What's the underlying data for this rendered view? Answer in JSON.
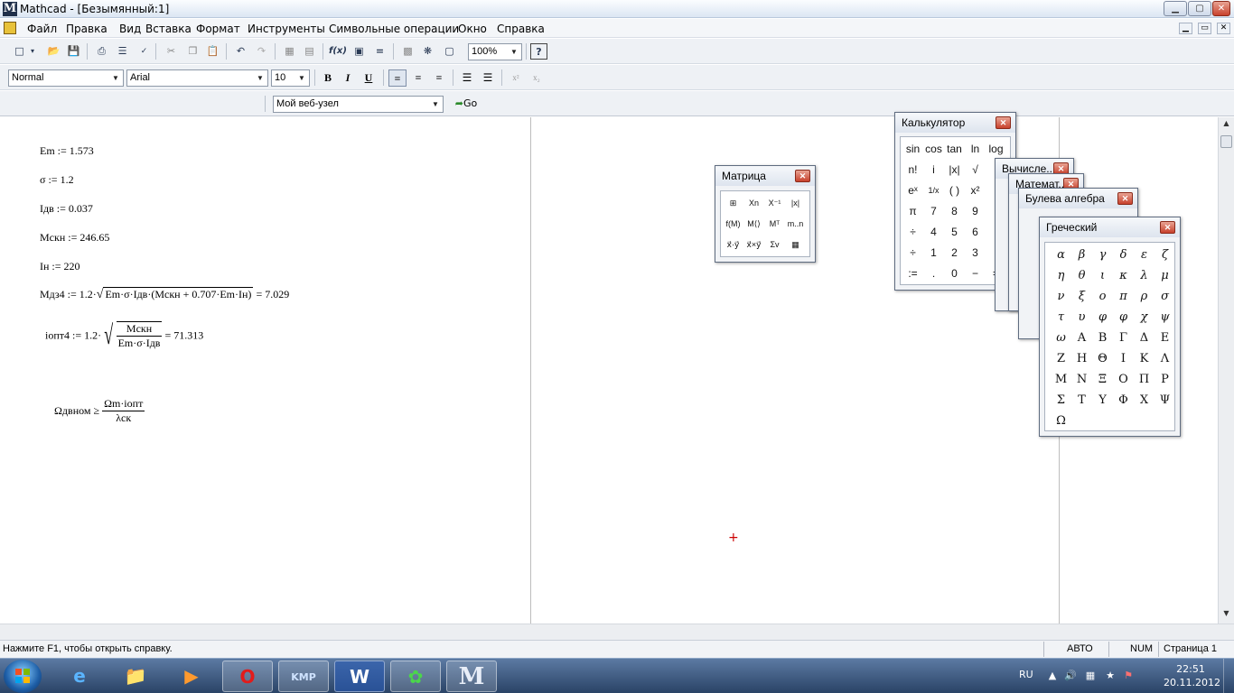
{
  "window": {
    "title": "Mathcad - [Безымянный:1]",
    "app_letter": "M",
    "minimize": "▁",
    "maximize": "▢",
    "close": "✕"
  },
  "menu": {
    "items": [
      "Файл",
      "Правка",
      "Вид",
      "Вставка",
      "Формат",
      "Инструменты",
      "Символьные операции",
      "Окно",
      "Справка"
    ],
    "mdi_minimize": "▁",
    "mdi_restore": "▭",
    "mdi_close": "✕"
  },
  "toolbar": {
    "zoom_value": "100%",
    "style_value": "Normal",
    "font_value": "Arial",
    "size_value": "10",
    "bold": "B",
    "italic": "I",
    "underline": "U",
    "superscript": "x²",
    "subscript": "x₂",
    "web_value": "Мой веб-узел",
    "go_label": "Go",
    "help_icon": "?"
  },
  "worksheet": {
    "lines": [
      "Em := 1.573",
      "σ := 1.2",
      "Iдв := 0.037",
      "Mскн := 246.65",
      "Iн := 220"
    ],
    "mdz4": {
      "lhs": "Mдз4 := 1.2·",
      "radicand": "Em·σ·Iдв·(Mскн + 0.707·Em·Iн)",
      "result": "= 7.029"
    },
    "iopt4": {
      "lhs": "iопт4 := 1.2·",
      "numerator": "Mскн",
      "denominator": "Em·σ·Iдв",
      "result": "= 71.313"
    },
    "omega": {
      "lhs": "Ωдвном ≥",
      "numerator": "Ωm·iопт",
      "denominator": "λск"
    },
    "cursor": "+"
  },
  "palettes": {
    "matrix": {
      "title": "Матрица",
      "cells": [
        "⊞",
        "Xn",
        "X⁻¹",
        "|x|",
        "f(M)",
        "M⟨⟩",
        "Mᵀ",
        "m..n",
        "x⃗·y⃗",
        "x⃗×y⃗",
        "Σv",
        "▦"
      ]
    },
    "calculator": {
      "title": "Калькулятор",
      "cells": [
        "sin",
        "cos",
        "tan",
        "ln",
        "log",
        "n!",
        "i",
        "|x|",
        "√",
        "eˣ",
        "1/x",
        "( )",
        "x²",
        "π",
        "7",
        "8",
        "9",
        "÷",
        "4",
        "5",
        "6",
        "÷",
        "1",
        "2",
        "3",
        ":=",
        ".",
        "0",
        "−",
        "="
      ]
    },
    "evaluation": {
      "title": "Вычисле..."
    },
    "calculus": {
      "title": "Математ..."
    },
    "boolean": {
      "title": "Булева алгебра"
    },
    "greek": {
      "title": "Греческий",
      "lower": [
        "α",
        "β",
        "γ",
        "δ",
        "ε",
        "ζ",
        "η",
        "θ",
        "ι",
        "κ",
        "λ",
        "μ",
        "ν",
        "ξ",
        "ο",
        "π",
        "ρ",
        "σ",
        "τ",
        "υ",
        "φ",
        "φ",
        "χ",
        "ψ",
        "ω"
      ],
      "upper": [
        "Α",
        "Β",
        "Γ",
        "Δ",
        "Ε",
        "Ζ",
        "Η",
        "Θ",
        "Ι",
        "Κ",
        "Λ",
        "Μ",
        "Ν",
        "Ξ",
        "Ο",
        "Π",
        "Ρ",
        "Σ",
        "Τ",
        "Υ",
        "Φ",
        "Χ",
        "Ψ",
        "Ω"
      ]
    }
  },
  "status": {
    "help": "Нажмите F1, чтобы открыть справку.",
    "auto": "АВТО",
    "num": "NUM",
    "page": "Страница 1"
  },
  "taskbar": {
    "apps": [
      "ie-icon",
      "explorer-icon",
      "media-player-icon",
      "opera-icon",
      "kmplayer-icon",
      "word-icon",
      "icq-icon",
      "mathcad-icon"
    ],
    "lang": "RU",
    "time": "22:51",
    "date": "20.11.2012"
  }
}
